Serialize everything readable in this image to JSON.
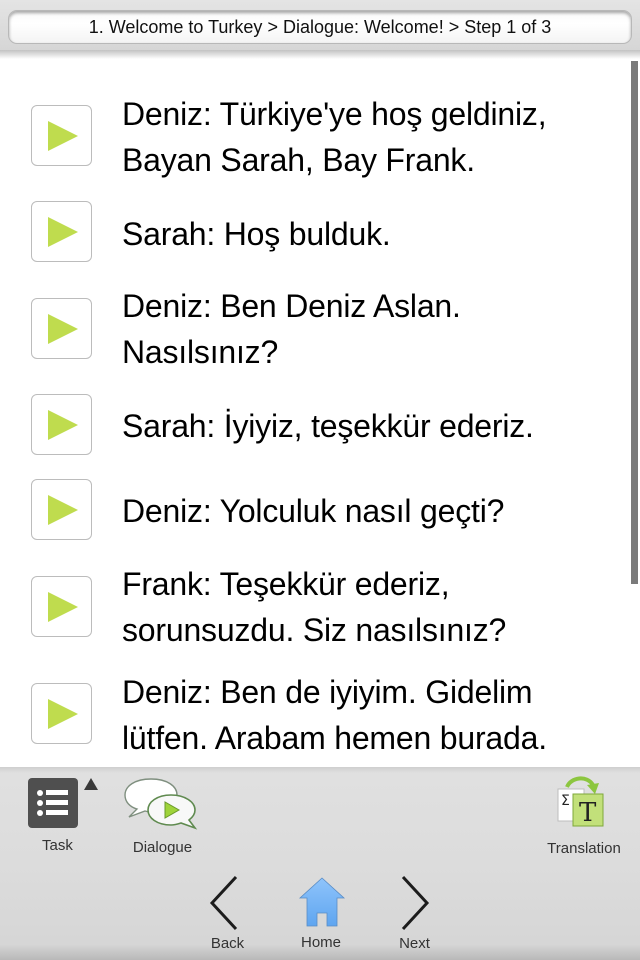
{
  "header": {
    "breadcrumb": "1. Welcome to Turkey > Dialogue: Welcome! > Step 1 of 3"
  },
  "dialogue": {
    "lines": [
      {
        "speaker": "Deniz",
        "text": "Deniz: Türkiye'ye hoş geldiniz, Bayan Sarah, Bay Frank."
      },
      {
        "speaker": "Sarah",
        "text": "Sarah: Hoş bulduk."
      },
      {
        "speaker": "Deniz",
        "text": "Deniz: Ben Deniz Aslan. Nasılsınız?"
      },
      {
        "speaker": "Sarah",
        "text": "Sarah: İyiyiz, teşekkür ederiz."
      },
      {
        "speaker": "Deniz",
        "text": "Deniz: Yolculuk nasıl geçti?"
      },
      {
        "speaker": "Frank",
        "text": "Frank: Teşekkür ederiz, sorunsuzdu. Siz nasılsınız?"
      },
      {
        "speaker": "Deniz",
        "text": "Deniz: Ben de iyiyim. Gidelim lütfen. Arabam hemen burada."
      }
    ],
    "play_icon": "play-icon",
    "accent_color": "#bfdc4e"
  },
  "toolbar": {
    "task_label": "Task",
    "dialogue_label": "Dialogue",
    "translation_label": "Translation",
    "back_label": "Back",
    "home_label": "Home",
    "next_label": "Next",
    "home_color": "#72b4f7"
  }
}
